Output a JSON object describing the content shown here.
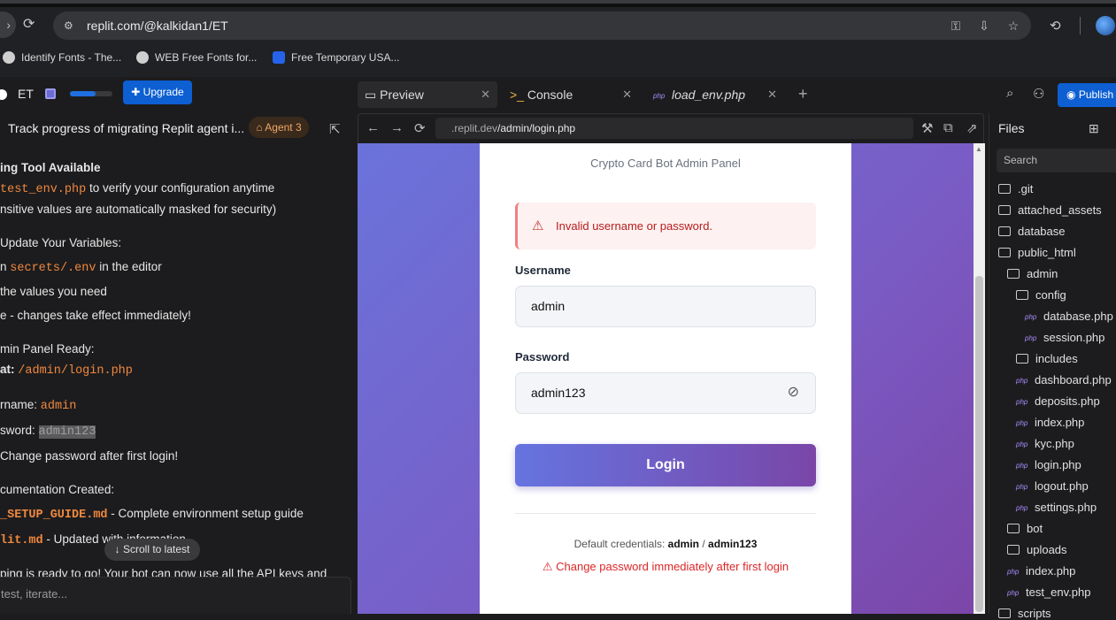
{
  "browser": {
    "url": "replit.com/@kalkidan1/ET",
    "bookmarks": [
      "Identify Fonts - The...",
      "WEB Free Fonts for...",
      "Free Temporary USA..."
    ]
  },
  "replit": {
    "project_name": "ET",
    "upgrade_label": "Upgrade",
    "publish_label": "Publish",
    "progress_fraction": 0.6,
    "task_title": "Track progress of migrating Replit agent i...",
    "agent_badge": "Agent 3",
    "scroll_latest": "Scroll to latest",
    "chat_placeholder": "test, iterate..."
  },
  "chat_lines": {
    "l1": "ing Tool Available",
    "l2_code": "test_env.php",
    "l2_text": " to verify your configuration anytime",
    "l3": "nsitive values are automatically masked for security)",
    "l4": "Update Your Variables:",
    "l5_pre": "n ",
    "l5_code": "secrets/.env",
    "l5_text": " in the editor",
    "l6": "the values you need",
    "l7": "e - changes take effect immediately!",
    "l8": "min Panel Ready:",
    "l9_label": "at:",
    "l9_code": "/admin/login.php",
    "l10_label": "rname:",
    "l10_code": "admin",
    "l11_label": "sword:",
    "l11_code": "admin123",
    "l12": "Change password after first login!",
    "l13": "cumentation Created:",
    "l14_code": "_SETUP_GUIDE.md",
    "l14_text": " - Complete environment setup guide",
    "l15_code": "lit.md",
    "l15_text": " - Updated with           information",
    "l16": "ping is ready to go! Your bot can now use all the API keys and"
  },
  "tabs": {
    "preview": "Preview",
    "console": "Console",
    "load_env": "load_env.php"
  },
  "preview": {
    "url_prefix": ".replit.dev",
    "url_path": "/admin/login.php",
    "subtitle": "Crypto Card Bot Admin Panel",
    "error": "Invalid username or password.",
    "username_label": "Username",
    "username_value": "admin",
    "password_label": "Password",
    "password_value": "admin123",
    "login_button": "Login",
    "creds_prefix": "Default credentials: ",
    "creds_user": "admin",
    "creds_sep": " / ",
    "creds_pass": "admin123",
    "warning": "Change password immediately after first login"
  },
  "files": {
    "title": "Files",
    "search_placeholder": "Search",
    "items": [
      {
        "name": ".git",
        "type": "folder"
      },
      {
        "name": "attached_assets",
        "type": "folder"
      },
      {
        "name": "database",
        "type": "folder"
      },
      {
        "name": "public_html",
        "type": "folder"
      },
      {
        "name": "admin",
        "type": "folder"
      },
      {
        "name": "config",
        "type": "folder"
      },
      {
        "name": "database.php",
        "type": "php"
      },
      {
        "name": "session.php",
        "type": "php"
      },
      {
        "name": "includes",
        "type": "folder"
      },
      {
        "name": "dashboard.php",
        "type": "php"
      },
      {
        "name": "deposits.php",
        "type": "php"
      },
      {
        "name": "index.php",
        "type": "php"
      },
      {
        "name": "kyc.php",
        "type": "php"
      },
      {
        "name": "login.php",
        "type": "php"
      },
      {
        "name": "logout.php",
        "type": "php"
      },
      {
        "name": "settings.php",
        "type": "php"
      },
      {
        "name": "bot",
        "type": "folder"
      },
      {
        "name": "uploads",
        "type": "folder"
      },
      {
        "name": "index.php",
        "type": "php"
      },
      {
        "name": "test_env.php",
        "type": "php"
      },
      {
        "name": "scripts",
        "type": "folder"
      }
    ]
  },
  "colors": {
    "accent_blue": "#0d5fd2",
    "code_orange": "#f0883e",
    "error_red": "#dc2626",
    "gradient_start": "#6574e0",
    "gradient_end": "#7a46a8"
  }
}
